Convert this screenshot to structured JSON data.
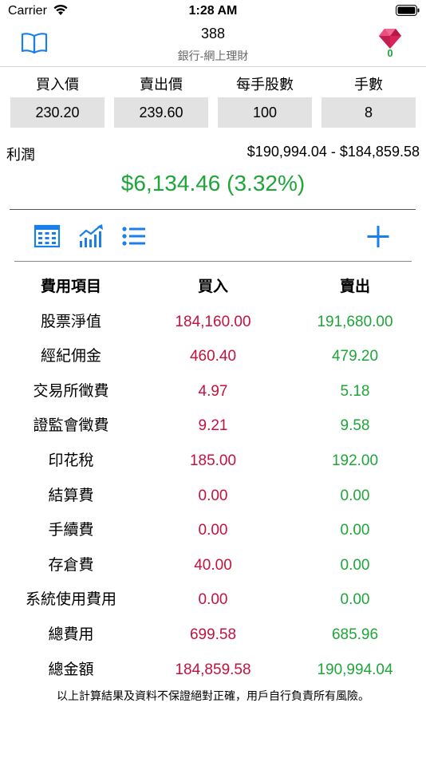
{
  "status_bar": {
    "carrier": "Carrier",
    "time": "1:28 AM"
  },
  "nav": {
    "title": "388",
    "subtitle": "銀行-網上理財",
    "left_icon": "book-icon",
    "right_icon": "gem-icon",
    "gem_count": "0",
    "accent_color": "#1a7fe8"
  },
  "inputs": [
    {
      "label": "買入價",
      "value": "230.20"
    },
    {
      "label": "賣出價",
      "value": "239.60"
    },
    {
      "label": "每手股數",
      "value": "100"
    },
    {
      "label": "手數",
      "value": "8"
    }
  ],
  "profit": {
    "label": "利潤",
    "range": "$190,994.04 - $184,859.58",
    "value": "$6,134.46 (3.32%)",
    "color": "#1fa53a"
  },
  "toolbar": {
    "icons": [
      "calculator-icon",
      "chart-icon",
      "list-icon",
      "add-icon"
    ]
  },
  "table": {
    "headers": [
      "費用項目",
      "買入",
      "賣出"
    ],
    "buy_color": "#c4123f",
    "sell_color": "#1fa53a",
    "rows": [
      {
        "item": "股票淨值",
        "buy": "184,160.00",
        "sell": "191,680.00"
      },
      {
        "item": "經紀佣金",
        "buy": "460.40",
        "sell": "479.20"
      },
      {
        "item": "交易所徵費",
        "buy": "4.97",
        "sell": "5.18"
      },
      {
        "item": "證監會徵費",
        "buy": "9.21",
        "sell": "9.58"
      },
      {
        "item": "印花稅",
        "buy": "185.00",
        "sell": "192.00"
      },
      {
        "item": "結算費",
        "buy": "0.00",
        "sell": "0.00"
      },
      {
        "item": "手續費",
        "buy": "0.00",
        "sell": "0.00"
      },
      {
        "item": "存倉費",
        "buy": "40.00",
        "sell": "0.00"
      },
      {
        "item": "系統使用費用",
        "buy": "0.00",
        "sell": "0.00"
      },
      {
        "item": "總費用",
        "buy": "699.58",
        "sell": "685.96"
      },
      {
        "item": "總金額",
        "buy": "184,859.58",
        "sell": "190,994.04"
      }
    ]
  },
  "disclaimer": "以上計算結果及資料不保證絕對正確，用戶自行負責所有風險。"
}
